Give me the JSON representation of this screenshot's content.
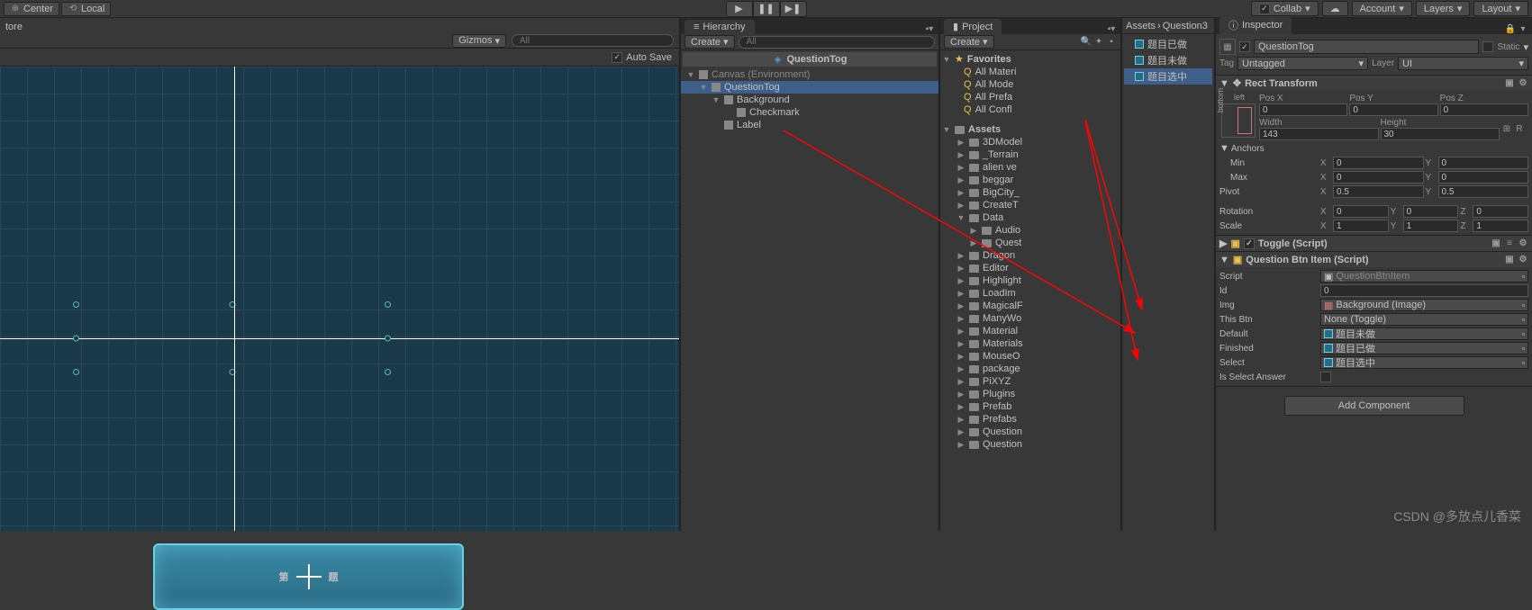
{
  "topbar": {
    "center": "Center",
    "local": "Local",
    "collab": "Collab",
    "account": "Account",
    "layers": "Layers",
    "layout": "Layout"
  },
  "scene": {
    "tore": "tore",
    "gizmos": "Gizmos",
    "search_ph": "All",
    "autosave": "Auto Save",
    "obj_text_left": "第",
    "obj_text_right": "题"
  },
  "hierarchy": {
    "title": "Hierarchy",
    "create": "Create",
    "search_ph": "All",
    "scene_name": "QuestionTog",
    "items": [
      {
        "name": "Canvas (Environment)",
        "depth": 0,
        "exp": "▼",
        "gray": true
      },
      {
        "name": "QuestionTog",
        "depth": 1,
        "exp": "▼",
        "sel": true
      },
      {
        "name": "Background",
        "depth": 2,
        "exp": "▼"
      },
      {
        "name": "Checkmark",
        "depth": 3,
        "exp": ""
      },
      {
        "name": "Label",
        "depth": 2,
        "exp": ""
      }
    ]
  },
  "project": {
    "title": "Project",
    "create": "Create",
    "favorites": "Favorites",
    "fav_items": [
      "All Materi",
      "All Mode",
      "All Prefa",
      "All Confl"
    ],
    "assets": "Assets",
    "folders": [
      "3DModel",
      "_Terrain",
      "alien ve",
      "beggar",
      "BigCity_",
      "CreateT"
    ],
    "data": "Data",
    "data_items": [
      "Audio",
      "Quest"
    ],
    "more": [
      "Dragon",
      "Editor",
      "Highlight",
      "LoadIm",
      "MagicalF",
      "ManyWo",
      "Material",
      "Materials",
      "MouseO",
      "package",
      "PiXYZ",
      "Plugins",
      "Prefab",
      "Prefabs",
      "Question",
      "Question"
    ]
  },
  "assets": {
    "bc1": "Assets",
    "bc2": "Question3",
    "items": [
      {
        "name": "题目已做"
      },
      {
        "name": "题目未做"
      },
      {
        "name": "题目选中",
        "sel": true
      }
    ]
  },
  "inspector": {
    "title": "Inspector",
    "name": "QuestionTog",
    "static": "Static",
    "tag_label": "Tag",
    "tag_val": "Untagged",
    "layer_label": "Layer",
    "layer_val": "UI",
    "rect": {
      "title": "Rect Transform",
      "anchor_v": "left",
      "anchor_h": "bottom",
      "posx_l": "Pos X",
      "posx": "0",
      "posy_l": "Pos Y",
      "posy": "0",
      "posz_l": "Pos Z",
      "posz": "0",
      "w_l": "Width",
      "w": "143",
      "h_l": "Height",
      "h": "30",
      "anchors": "Anchors",
      "min": "Min",
      "min_x": "0",
      "min_y": "0",
      "max": "Max",
      "max_x": "0",
      "max_y": "0",
      "pivot": "Pivot",
      "piv_x": "0.5",
      "piv_y": "0.5",
      "rot": "Rotation",
      "rx": "0",
      "ry": "0",
      "rz": "0",
      "scale": "Scale",
      "sx": "1",
      "sy": "1",
      "sz": "1"
    },
    "toggle": {
      "title": "Toggle (Script)"
    },
    "qbi": {
      "title": "Question Btn Item (Script)",
      "script_l": "Script",
      "script": "QuestionBtnItem",
      "id_l": "Id",
      "id": "0",
      "img_l": "Img",
      "img": "Background (Image)",
      "btn_l": "This Btn",
      "btn": "None (Toggle)",
      "def_l": "Default",
      "def": "题目未做",
      "fin_l": "Finished",
      "fin": "题目已做",
      "sel_l": "Select",
      "sel": "题目选中",
      "isa_l": "Is Select Answer"
    },
    "add": "Add Component"
  },
  "watermark": "CSDN @多放点儿香菜"
}
